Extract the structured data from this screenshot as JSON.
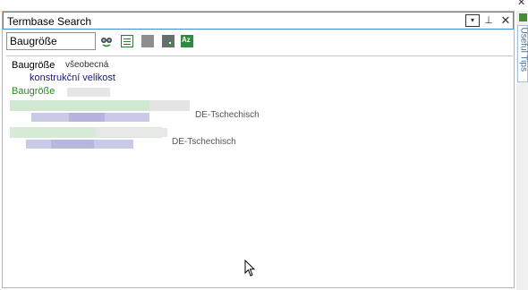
{
  "window": {
    "close_glyph": "✕"
  },
  "panel": {
    "title": "Termbase Search",
    "dropdown_glyph": "▾",
    "pin_glyph": "⊥",
    "close_glyph": "✕"
  },
  "search": {
    "value": "Baugröße"
  },
  "toolbar": {
    "icons": [
      "search-binoculars-icon",
      "add-term-icon",
      "edit-term-icon",
      "termbase-settings-icon",
      "sort-az-icon"
    ]
  },
  "results": {
    "header_term": "Baugröße",
    "header_domain": "všeobecná",
    "target_term": "konstrukční velikost",
    "source_term": "Baugröße",
    "rows": [
      {
        "lang": "DE-Tschechisch"
      },
      {
        "lang": "DE-Tschechisch"
      }
    ]
  },
  "side_panel": {
    "tab_label": "Useful Tips"
  }
}
